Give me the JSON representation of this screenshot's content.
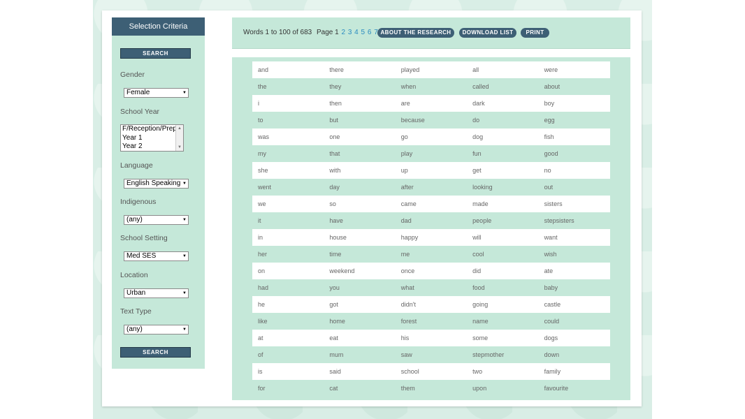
{
  "sidebar": {
    "title": "Selection Criteria",
    "search_label": "SEARCH",
    "gender": {
      "label": "Gender",
      "value": "Female"
    },
    "school_year": {
      "label": "School Year",
      "options": [
        "F/Reception/Prep",
        "Year 1",
        "Year 2"
      ]
    },
    "language": {
      "label": "Language",
      "value": "English Speaking"
    },
    "indigenous": {
      "label": "Indigenous",
      "value": "(any)"
    },
    "school_setting": {
      "label": "School Setting",
      "value": "Med SES"
    },
    "location": {
      "label": "Location",
      "value": "Urban"
    },
    "text_type": {
      "label": "Text Type",
      "value": "(any)"
    }
  },
  "topbar": {
    "words_info": "Words 1 to 100 of 683",
    "page_label": "Page 1",
    "pages": [
      "2",
      "3",
      "4",
      "5",
      "6",
      "7"
    ],
    "about_label": "ABOUT THE RESEARCH",
    "download_label": "DOWNLOAD LIST",
    "print_label": "PRINT"
  },
  "words": [
    [
      "and",
      "there",
      "played",
      "all",
      "were"
    ],
    [
      "the",
      "they",
      "when",
      "called",
      "about"
    ],
    [
      "i",
      "then",
      "are",
      "dark",
      "boy"
    ],
    [
      "to",
      "but",
      "because",
      "do",
      "egg"
    ],
    [
      "was",
      "one",
      "go",
      "dog",
      "fish"
    ],
    [
      "my",
      "that",
      "play",
      "fun",
      "good"
    ],
    [
      "she",
      "with",
      "up",
      "get",
      "no"
    ],
    [
      "went",
      "day",
      "after",
      "looking",
      "out"
    ],
    [
      "we",
      "so",
      "came",
      "made",
      "sisters"
    ],
    [
      "it",
      "have",
      "dad",
      "people",
      "stepsisters"
    ],
    [
      "in",
      "house",
      "happy",
      "will",
      "want"
    ],
    [
      "her",
      "time",
      "me",
      "cool",
      "wish"
    ],
    [
      "on",
      "weekend",
      "once",
      "did",
      "ate"
    ],
    [
      "had",
      "you",
      "what",
      "food",
      "baby"
    ],
    [
      "he",
      "got",
      "didn't",
      "going",
      "castle"
    ],
    [
      "like",
      "home",
      "forest",
      "name",
      "could"
    ],
    [
      "at",
      "eat",
      "his",
      "some",
      "dogs"
    ],
    [
      "of",
      "mum",
      "saw",
      "stepmother",
      "down"
    ],
    [
      "is",
      "said",
      "school",
      "two",
      "family"
    ],
    [
      "for",
      "cat",
      "them",
      "upon",
      "favourite"
    ]
  ]
}
